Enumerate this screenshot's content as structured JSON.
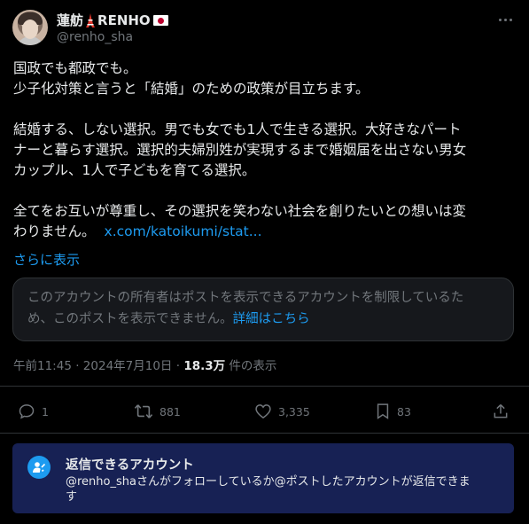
{
  "author": {
    "display_name": "蓮舫",
    "display_name_suffix": "RENHO",
    "handle": "@renho_sha",
    "emoji": [
      "tokyo-tower-icon",
      "japan-flag-icon"
    ]
  },
  "tweet": {
    "lines": [
      "国政でも都政でも。",
      "少子化対策と言うと「結婚」のための政策が目立ちます。",
      "",
      "結婚する、しない選択。男でも女でも1人で生きる選択。大好きなパート",
      "ナーと暮らす選択。選択的夫婦別姓が実現するまで婚姻届を出さない男女",
      "カップル、1人で子どもを育てる選択。",
      "",
      "全てをお互いが尊重し、その選択を笑わない社会を創りたいとの想いは変",
      "わりません。"
    ],
    "link_text": "x.com/katoikumi/stat...",
    "show_more": "さらに表示"
  },
  "notice": {
    "text": "このアカウントの所有者はポストを表示できるアカウントを制限しているた",
    "text2": "め、このポストを表示できません。",
    "link": "詳細はこちら"
  },
  "meta": {
    "time": "午前11:45",
    "separator": "·",
    "date": "2024年7月10日",
    "views_count": "18.3万",
    "views_label": "件の表示"
  },
  "actions": {
    "replies": "1",
    "reposts": "881",
    "likes": "3,335",
    "bookmarks": "83"
  },
  "reply_restriction": {
    "title": "返信できるアカウント",
    "description": "@renho_shaさんがフォローしているか@ポストしたアカウントが返信できま",
    "description2": "す"
  },
  "colors": {
    "background": "#000000",
    "text": "#e7e9ea",
    "muted": "#71767b",
    "accent": "#1d9bf0",
    "reply_box": "#172154"
  }
}
